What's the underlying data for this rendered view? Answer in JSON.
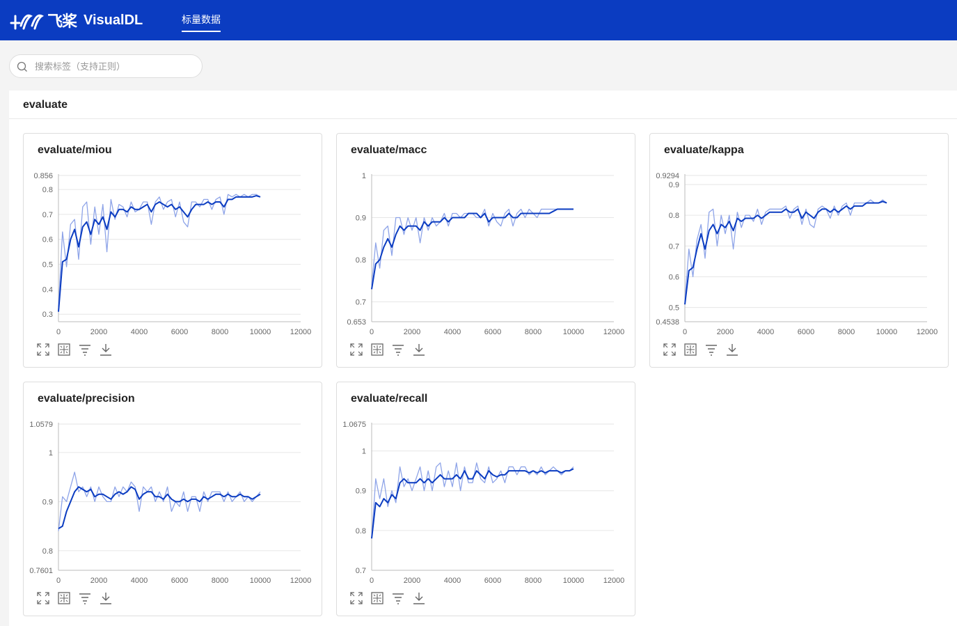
{
  "app": {
    "logo_cn": "飞桨",
    "logo_en": "VisualDL"
  },
  "nav": {
    "tabs": [
      {
        "label": "标量数据",
        "active": true
      }
    ]
  },
  "search": {
    "placeholder": "搜索标签（支持正则）",
    "value": ""
  },
  "group": {
    "title": "evaluate"
  },
  "colors": {
    "smoothed": "#0b3cc1",
    "raw": "#8ea4e8",
    "header": "#0b3cc1"
  },
  "toolbar_icons": [
    "maximize-icon",
    "fit-icon",
    "filter-icon",
    "download-icon"
  ],
  "cards": [
    {
      "title": "evaluate/miou"
    },
    {
      "title": "evaluate/macc"
    },
    {
      "title": "evaluate/kappa"
    },
    {
      "title": "evaluate/precision"
    },
    {
      "title": "evaluate/recall"
    }
  ],
  "chart_data": [
    {
      "type": "line",
      "title": "evaluate/miou",
      "x": [
        0,
        200,
        400,
        600,
        800,
        1000,
        1200,
        1400,
        1600,
        1800,
        2000,
        2200,
        2400,
        2600,
        2800,
        3000,
        3200,
        3400,
        3600,
        3800,
        4000,
        4200,
        4400,
        4600,
        4800,
        5000,
        5200,
        5400,
        5600,
        5800,
        6000,
        6200,
        6400,
        6600,
        6800,
        7000,
        7200,
        7400,
        7600,
        7800,
        8000,
        8200,
        8400,
        8600,
        8800,
        9000,
        9200,
        9400,
        9600,
        9800,
        10000
      ],
      "xlim": [
        0,
        12000
      ],
      "ylim": [
        0.27,
        0.856
      ],
      "xticks": [
        "0",
        "2000",
        "4000",
        "6000",
        "8000",
        "10000",
        "12000"
      ],
      "yticks": [
        "0.3",
        "0.4",
        "0.5",
        "0.6",
        "0.7",
        "0.8"
      ],
      "ymax_label": "0.856",
      "series": [
        {
          "role": "smoothed",
          "values": [
            0.31,
            0.51,
            0.52,
            0.6,
            0.64,
            0.57,
            0.65,
            0.67,
            0.62,
            0.68,
            0.66,
            0.69,
            0.64,
            0.71,
            0.69,
            0.72,
            0.72,
            0.71,
            0.73,
            0.72,
            0.72,
            0.73,
            0.74,
            0.71,
            0.74,
            0.75,
            0.74,
            0.73,
            0.74,
            0.72,
            0.73,
            0.71,
            0.69,
            0.72,
            0.74,
            0.74,
            0.74,
            0.75,
            0.74,
            0.75,
            0.75,
            0.73,
            0.76,
            0.76,
            0.77,
            0.77,
            0.77,
            0.77,
            0.77,
            0.775,
            0.77
          ]
        },
        {
          "role": "raw",
          "values": [
            0.33,
            0.63,
            0.49,
            0.66,
            0.68,
            0.52,
            0.73,
            0.75,
            0.58,
            0.73,
            0.62,
            0.74,
            0.55,
            0.76,
            0.68,
            0.74,
            0.73,
            0.69,
            0.75,
            0.71,
            0.72,
            0.75,
            0.75,
            0.66,
            0.75,
            0.77,
            0.72,
            0.75,
            0.76,
            0.69,
            0.75,
            0.67,
            0.65,
            0.75,
            0.75,
            0.73,
            0.76,
            0.76,
            0.72,
            0.76,
            0.77,
            0.7,
            0.78,
            0.77,
            0.78,
            0.77,
            0.78,
            0.77,
            0.78,
            0.78,
            0.77
          ]
        }
      ]
    },
    {
      "type": "line",
      "title": "evaluate/macc",
      "x": [
        0,
        200,
        400,
        600,
        800,
        1000,
        1200,
        1400,
        1600,
        1800,
        2000,
        2200,
        2400,
        2600,
        2800,
        3000,
        3200,
        3400,
        3600,
        3800,
        4000,
        4200,
        4400,
        4600,
        4800,
        5000,
        5200,
        5400,
        5600,
        5800,
        6000,
        6200,
        6400,
        6600,
        6800,
        7000,
        7200,
        7400,
        7600,
        7800,
        8000,
        8200,
        8400,
        8600,
        8800,
        9000,
        9200,
        9400,
        9600,
        9800,
        10000
      ],
      "xlim": [
        0,
        12000
      ],
      "ylim": [
        0.653,
        1.0
      ],
      "xticks": [
        "0",
        "2000",
        "4000",
        "6000",
        "8000",
        "10000",
        "12000"
      ],
      "yticks": [
        "0.7",
        "0.8",
        "0.9",
        "1"
      ],
      "ymin_label": "0.653",
      "series": [
        {
          "role": "smoothed",
          "values": [
            0.73,
            0.79,
            0.8,
            0.83,
            0.85,
            0.83,
            0.86,
            0.88,
            0.87,
            0.88,
            0.88,
            0.88,
            0.87,
            0.89,
            0.88,
            0.89,
            0.89,
            0.89,
            0.9,
            0.89,
            0.9,
            0.9,
            0.9,
            0.9,
            0.91,
            0.91,
            0.91,
            0.9,
            0.91,
            0.89,
            0.9,
            0.9,
            0.9,
            0.9,
            0.91,
            0.9,
            0.9,
            0.91,
            0.91,
            0.91,
            0.91,
            0.91,
            0.91,
            0.91,
            0.91,
            0.915,
            0.92,
            0.92,
            0.92,
            0.92,
            0.92
          ]
        },
        {
          "role": "raw",
          "values": [
            0.74,
            0.84,
            0.78,
            0.87,
            0.88,
            0.81,
            0.9,
            0.9,
            0.86,
            0.9,
            0.87,
            0.9,
            0.84,
            0.9,
            0.87,
            0.9,
            0.88,
            0.89,
            0.91,
            0.88,
            0.91,
            0.91,
            0.9,
            0.91,
            0.91,
            0.91,
            0.9,
            0.9,
            0.92,
            0.88,
            0.91,
            0.89,
            0.88,
            0.91,
            0.92,
            0.88,
            0.91,
            0.92,
            0.9,
            0.92,
            0.91,
            0.9,
            0.92,
            0.92,
            0.92,
            0.92,
            0.92,
            0.92,
            0.92,
            0.92,
            0.92
          ]
        }
      ]
    },
    {
      "type": "line",
      "title": "evaluate/kappa",
      "x": [
        0,
        200,
        400,
        600,
        800,
        1000,
        1200,
        1400,
        1600,
        1800,
        2000,
        2200,
        2400,
        2600,
        2800,
        3000,
        3200,
        3400,
        3600,
        3800,
        4000,
        4200,
        4400,
        4600,
        4800,
        5000,
        5200,
        5400,
        5600,
        5800,
        6000,
        6200,
        6400,
        6600,
        6800,
        7000,
        7200,
        7400,
        7600,
        7800,
        8000,
        8200,
        8400,
        8600,
        8800,
        9000,
        9200,
        9400,
        9600,
        9800,
        10000
      ],
      "xlim": [
        0,
        12000
      ],
      "ylim": [
        0.4538,
        0.9294
      ],
      "xticks": [
        "0",
        "2000",
        "4000",
        "6000",
        "8000",
        "10000",
        "12000"
      ],
      "yticks": [
        "0.5",
        "0.6",
        "0.7",
        "0.8",
        "0.9"
      ],
      "ymax_label": "0.9294",
      "ymin_label": "0.4538",
      "series": [
        {
          "role": "smoothed",
          "values": [
            0.51,
            0.62,
            0.63,
            0.69,
            0.74,
            0.69,
            0.75,
            0.77,
            0.74,
            0.77,
            0.76,
            0.78,
            0.75,
            0.79,
            0.78,
            0.79,
            0.79,
            0.79,
            0.8,
            0.79,
            0.8,
            0.81,
            0.81,
            0.81,
            0.81,
            0.82,
            0.81,
            0.81,
            0.82,
            0.79,
            0.81,
            0.8,
            0.79,
            0.81,
            0.82,
            0.82,
            0.81,
            0.82,
            0.81,
            0.82,
            0.83,
            0.82,
            0.83,
            0.83,
            0.83,
            0.84,
            0.84,
            0.84,
            0.84,
            0.845,
            0.84
          ]
        },
        {
          "role": "raw",
          "values": [
            0.52,
            0.69,
            0.6,
            0.72,
            0.77,
            0.66,
            0.81,
            0.82,
            0.7,
            0.8,
            0.74,
            0.8,
            0.69,
            0.81,
            0.76,
            0.8,
            0.8,
            0.78,
            0.82,
            0.77,
            0.81,
            0.82,
            0.82,
            0.82,
            0.82,
            0.83,
            0.79,
            0.82,
            0.83,
            0.77,
            0.82,
            0.77,
            0.76,
            0.82,
            0.83,
            0.82,
            0.79,
            0.83,
            0.8,
            0.83,
            0.84,
            0.8,
            0.84,
            0.84,
            0.84,
            0.84,
            0.85,
            0.84,
            0.84,
            0.85,
            0.84
          ]
        }
      ]
    },
    {
      "type": "line",
      "title": "evaluate/precision",
      "x": [
        0,
        200,
        400,
        600,
        800,
        1000,
        1200,
        1400,
        1600,
        1800,
        2000,
        2200,
        2400,
        2600,
        2800,
        3000,
        3200,
        3400,
        3600,
        3800,
        4000,
        4200,
        4400,
        4600,
        4800,
        5000,
        5200,
        5400,
        5600,
        5800,
        6000,
        6200,
        6400,
        6600,
        6800,
        7000,
        7200,
        7400,
        7600,
        7800,
        8000,
        8200,
        8400,
        8600,
        8800,
        9000,
        9200,
        9400,
        9600,
        9800,
        10000
      ],
      "xlim": [
        0,
        12000
      ],
      "ylim": [
        0.7601,
        1.0579
      ],
      "xticks": [
        "0",
        "2000",
        "4000",
        "6000",
        "8000",
        "10000",
        "12000"
      ],
      "yticks": [
        "0.8",
        "0.9",
        "1"
      ],
      "ymax_label": "1.0579",
      "ymin_label": "0.7601",
      "series": [
        {
          "role": "smoothed",
          "values": [
            0.845,
            0.85,
            0.88,
            0.9,
            0.92,
            0.93,
            0.925,
            0.92,
            0.925,
            0.91,
            0.915,
            0.915,
            0.91,
            0.905,
            0.915,
            0.92,
            0.915,
            0.92,
            0.93,
            0.925,
            0.905,
            0.915,
            0.92,
            0.92,
            0.91,
            0.91,
            0.905,
            0.915,
            0.905,
            0.9,
            0.9,
            0.905,
            0.9,
            0.905,
            0.905,
            0.9,
            0.91,
            0.905,
            0.91,
            0.915,
            0.915,
            0.91,
            0.915,
            0.91,
            0.91,
            0.915,
            0.91,
            0.91,
            0.905,
            0.91,
            0.915
          ]
        },
        {
          "role": "raw",
          "values": [
            0.84,
            0.91,
            0.9,
            0.93,
            0.96,
            0.92,
            0.93,
            0.91,
            0.93,
            0.9,
            0.93,
            0.91,
            0.9,
            0.9,
            0.93,
            0.91,
            0.93,
            0.92,
            0.94,
            0.93,
            0.88,
            0.93,
            0.92,
            0.93,
            0.9,
            0.92,
            0.9,
            0.93,
            0.88,
            0.9,
            0.89,
            0.92,
            0.88,
            0.91,
            0.91,
            0.88,
            0.92,
            0.9,
            0.92,
            0.92,
            0.92,
            0.9,
            0.92,
            0.9,
            0.91,
            0.92,
            0.9,
            0.91,
            0.9,
            0.91,
            0.92
          ]
        }
      ]
    },
    {
      "type": "line",
      "title": "evaluate/recall",
      "x": [
        0,
        200,
        400,
        600,
        800,
        1000,
        1200,
        1400,
        1600,
        1800,
        2000,
        2200,
        2400,
        2600,
        2800,
        3000,
        3200,
        3400,
        3600,
        3800,
        4000,
        4200,
        4400,
        4600,
        4800,
        5000,
        5200,
        5400,
        5600,
        5800,
        6000,
        6200,
        6400,
        6600,
        6800,
        7000,
        7200,
        7400,
        7600,
        7800,
        8000,
        8200,
        8400,
        8600,
        8800,
        9000,
        9200,
        9400,
        9600,
        9800,
        10000
      ],
      "xlim": [
        0,
        12000
      ],
      "ylim": [
        0.7,
        1.0675
      ],
      "xticks": [
        "0",
        "2000",
        "4000",
        "6000",
        "8000",
        "10000",
        "12000"
      ],
      "yticks": [
        "0.7",
        "0.8",
        "0.9",
        "1"
      ],
      "ymax_label": "1.0675",
      "series": [
        {
          "role": "smoothed",
          "values": [
            0.78,
            0.87,
            0.86,
            0.88,
            0.87,
            0.89,
            0.88,
            0.92,
            0.93,
            0.92,
            0.92,
            0.92,
            0.93,
            0.92,
            0.93,
            0.92,
            0.93,
            0.94,
            0.93,
            0.93,
            0.93,
            0.94,
            0.93,
            0.95,
            0.93,
            0.93,
            0.95,
            0.94,
            0.93,
            0.95,
            0.94,
            0.935,
            0.94,
            0.94,
            0.95,
            0.95,
            0.95,
            0.95,
            0.95,
            0.945,
            0.95,
            0.945,
            0.95,
            0.945,
            0.95,
            0.95,
            0.95,
            0.945,
            0.95,
            0.95,
            0.955
          ]
        },
        {
          "role": "raw",
          "values": [
            0.78,
            0.93,
            0.88,
            0.93,
            0.86,
            0.9,
            0.87,
            0.96,
            0.91,
            0.93,
            0.9,
            0.93,
            0.96,
            0.9,
            0.95,
            0.9,
            0.96,
            0.97,
            0.91,
            0.95,
            0.91,
            0.97,
            0.9,
            0.96,
            0.92,
            0.92,
            0.97,
            0.93,
            0.92,
            0.96,
            0.92,
            0.93,
            0.95,
            0.92,
            0.96,
            0.96,
            0.94,
            0.96,
            0.96,
            0.94,
            0.95,
            0.94,
            0.96,
            0.94,
            0.95,
            0.96,
            0.95,
            0.94,
            0.95,
            0.95,
            0.96
          ]
        }
      ]
    }
  ]
}
